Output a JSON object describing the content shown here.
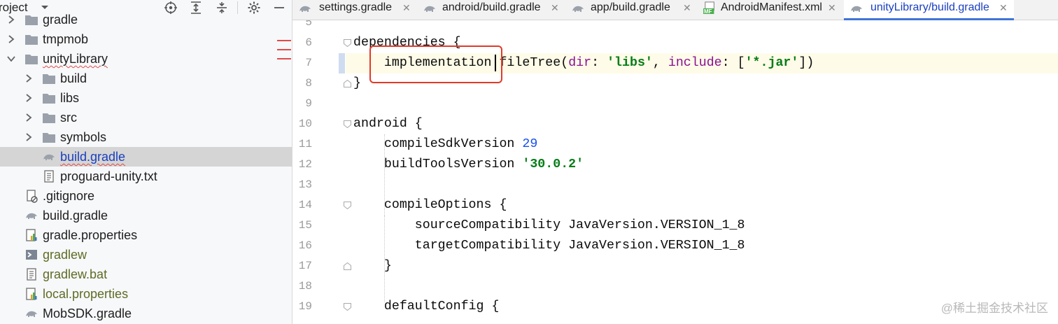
{
  "project_panel": {
    "title": "roject",
    "tree": [
      {
        "label": "gradle",
        "type": "folder",
        "color": "normal",
        "arrow": "right"
      },
      {
        "label": "tmpmob",
        "type": "folder",
        "color": "normal",
        "arrow": "right"
      },
      {
        "label": "unityLibrary",
        "type": "folder",
        "color": "normal",
        "arrow": "down",
        "squiggle": true
      },
      {
        "label": "build",
        "type": "folder",
        "color": "normal",
        "arrow": "right"
      },
      {
        "label": "libs",
        "type": "folder",
        "color": "normal",
        "arrow": "right"
      },
      {
        "label": "src",
        "type": "folder",
        "color": "normal",
        "arrow": "right"
      },
      {
        "label": "symbols",
        "type": "folder",
        "color": "normal",
        "arrow": "right"
      },
      {
        "label": "build.gradle",
        "type": "gradle",
        "color": "link",
        "selected": true,
        "squiggle": true
      },
      {
        "label": "proguard-unity.txt",
        "type": "text"
      },
      {
        "label": ".gitignore",
        "type": "ignore"
      },
      {
        "label": "build.gradle",
        "type": "gradle"
      },
      {
        "label": "gradle.properties",
        "type": "properties"
      },
      {
        "label": "gradlew",
        "type": "shell",
        "color": "olive"
      },
      {
        "label": "gradlew.bat",
        "type": "text",
        "color": "olive"
      },
      {
        "label": "local.properties",
        "type": "properties",
        "color": "olive"
      },
      {
        "label": "MobSDK.gradle",
        "type": "gradle"
      }
    ]
  },
  "tabs": [
    {
      "label": "settings.gradle",
      "icon": "gradle-icon"
    },
    {
      "label": "android/build.gradle",
      "icon": "gradle-icon"
    },
    {
      "label": "app/build.gradle",
      "icon": "gradle-icon"
    },
    {
      "label": "AndroidManifest.xml",
      "icon": "manifest-icon",
      "badge": "MF"
    },
    {
      "label": "unityLibrary/build.gradle",
      "icon": "gradle-icon",
      "active": true
    }
  ],
  "editor": {
    "line_numbers": [
      "5",
      "6",
      "7",
      "8",
      "9",
      "10",
      "11",
      "12",
      "13",
      "14",
      "15",
      "16",
      "17",
      "18",
      "19"
    ],
    "lines": [
      {
        "n": "5",
        "t": ""
      },
      {
        "n": "6",
        "t": "dependencies {"
      },
      {
        "n": "7",
        "t": "    implementation fileTree(dir: 'libs', include: ['*.jar'])"
      },
      {
        "n": "8",
        "t": "}"
      },
      {
        "n": "9",
        "t": ""
      },
      {
        "n": "10",
        "t": "android {"
      },
      {
        "n": "11",
        "t": "    compileSdkVersion 29"
      },
      {
        "n": "12",
        "t": "    buildToolsVersion '30.0.2'"
      },
      {
        "n": "13",
        "t": ""
      },
      {
        "n": "14",
        "t": "    compileOptions {"
      },
      {
        "n": "15",
        "t": "        sourceCompatibility JavaVersion.VERSION_1_8"
      },
      {
        "n": "16",
        "t": "        targetCompatibility JavaVersion.VERSION_1_8"
      },
      {
        "n": "17",
        "t": "    }"
      },
      {
        "n": "18",
        "t": ""
      },
      {
        "n": "19",
        "t": "    defaultConfig {"
      }
    ],
    "highlighted_text": "implementation"
  },
  "watermark": "@稀土掘金技术社区",
  "colors": {
    "accent": "#3f74d6",
    "highlight_box": "#e03a2a",
    "keyword": "#0033b3",
    "string": "#067d17",
    "number": "#1750eb",
    "param": "#871094"
  }
}
